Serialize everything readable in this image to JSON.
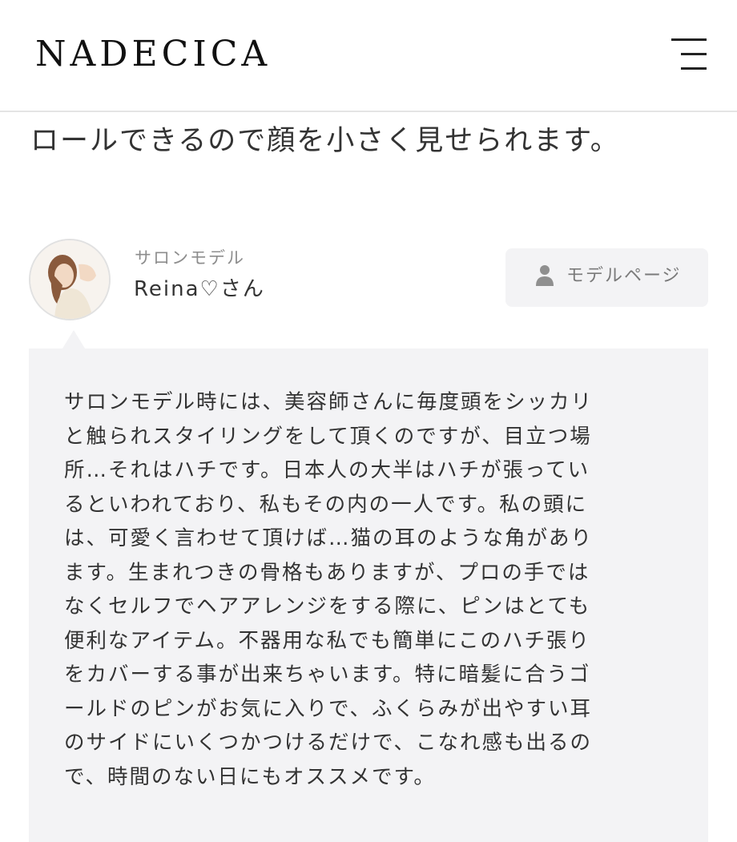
{
  "header": {
    "logo_text": "NADECICA",
    "menu_icon": "hamburger-menu-icon"
  },
  "article": {
    "intro_line": "ロールできるので顔を小さく見せられます。"
  },
  "model": {
    "role": "サロンモデル",
    "name": "Reina♡さん",
    "avatar_icon": "model-avatar-photo",
    "page_button_icon": "person-icon",
    "page_button_label": "モデルページ"
  },
  "comment": {
    "lines": [
      "サロンモデル時には、美容師さんに毎度頭をシッカリ",
      "と触られスタイリングをして頂くのですが、目立つ場",
      "所…それはハチです。日本人の大半はハチが張ってい",
      "るといわれており、私もその内の一人です。私の頭に",
      "は、可愛く言わせて頂けば…猫の耳のような角があり",
      "ます。生まれつきの骨格もありますが、プロの手では",
      "なくセルフでヘアアレンジをする際に、ピンはとても",
      "便利なアイテム。不器用な私でも簡単にこのハチ張り",
      "をカバーする事が出来ちゃいます。特に暗髪に合うゴ",
      "ールドのピンがお気に入りで、ふくらみが出やすい耳",
      "のサイドにいくつかつけるだけで、こなれ感も出るの",
      "で、時間のない日にもオススメです。"
    ]
  },
  "colors": {
    "bubble_background": "#f3f3f5",
    "text": "#333333",
    "muted_text": "#8d8d8d"
  }
}
